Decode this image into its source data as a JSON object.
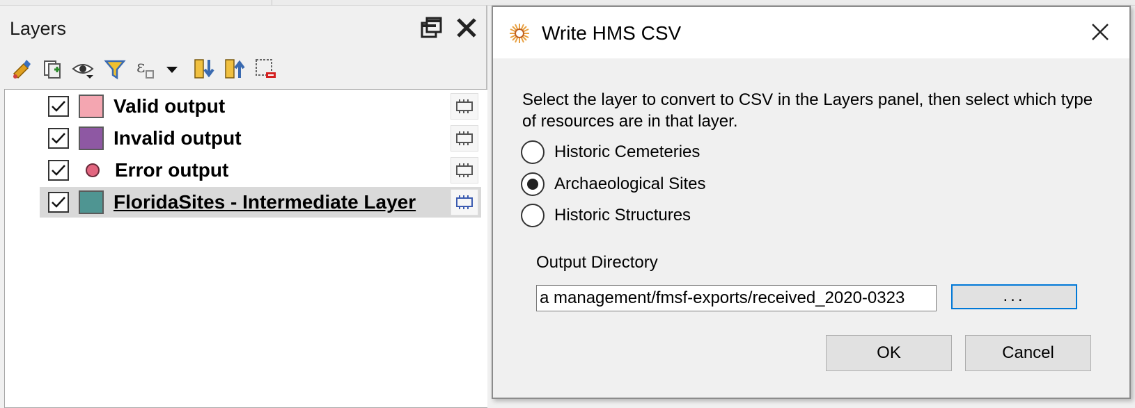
{
  "layers_panel": {
    "title": "Layers",
    "layers": [
      {
        "label": "Valid output",
        "checked": true,
        "symbol": "square",
        "color": "#f4a6b1"
      },
      {
        "label": "Invalid output",
        "checked": true,
        "symbol": "square",
        "color": "#8e58a3"
      },
      {
        "label": "Error output",
        "checked": true,
        "symbol": "circle",
        "color": "#e2657f"
      },
      {
        "label": "FloridaSites - Intermediate Layer",
        "checked": true,
        "symbol": "square",
        "color": "#4f9592",
        "selected": true
      }
    ],
    "toolbar_icons": [
      "style-manager-icon",
      "add-group-icon",
      "visibility-icon",
      "filter-icon",
      "expression-filter-icon",
      "dropdown-arrow-icon",
      "expand-all-icon",
      "collapse-all-icon",
      "remove-layer-icon"
    ]
  },
  "dialog": {
    "title": "Write HMS CSV",
    "instructions": "Select the layer to convert to CSV in the Layers panel, then select which type of resources are in that layer.",
    "options": [
      {
        "label": "Historic Cemeteries",
        "checked": false
      },
      {
        "label": "Archaeological Sites",
        "checked": true
      },
      {
        "label": "Historic Structures",
        "checked": false
      }
    ],
    "output_label": "Output Directory",
    "output_value": "a management/fmsf-exports/received_2020-0323",
    "browse_label": "...",
    "ok_label": "OK",
    "cancel_label": "Cancel"
  }
}
